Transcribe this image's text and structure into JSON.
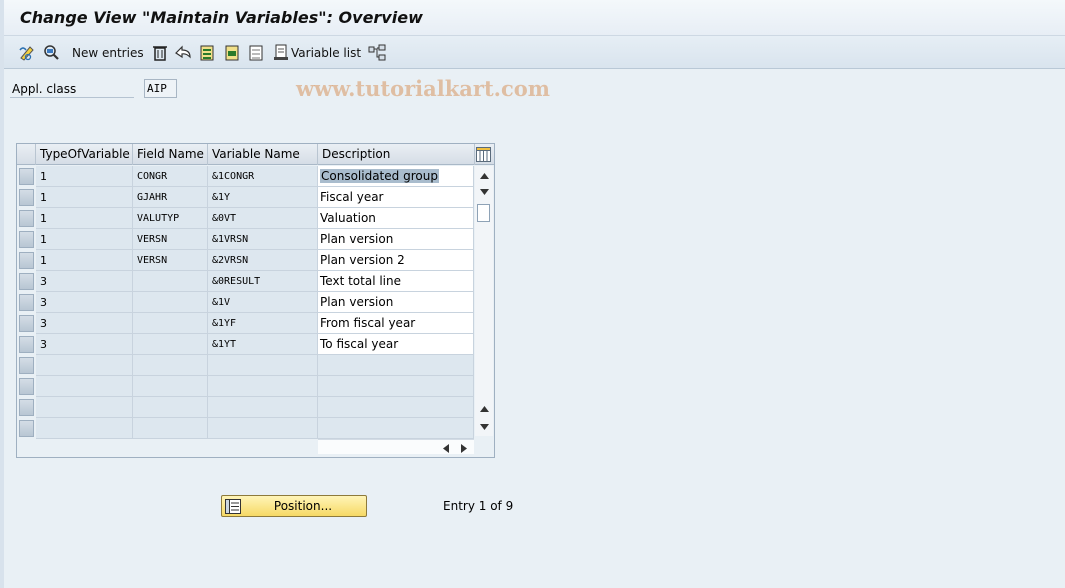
{
  "window": {
    "title": "Change View \"Maintain Variables\": Overview"
  },
  "toolbar": {
    "new_entries_label": "New entries",
    "variable_list_label": "Variable list",
    "icons": [
      "display-change-icon",
      "details-icon",
      "new-entries-icon",
      "delete-icon",
      "undo-icon",
      "select-all-icon",
      "select-block-icon",
      "deselect-all-icon",
      "print-icon",
      "variable-list-icon",
      "structure-icon"
    ]
  },
  "watermark": "www.tutorialkart.com",
  "form": {
    "appl_class_label": "Appl. class",
    "appl_class_value": "AIP"
  },
  "table": {
    "columns": [
      "TypeOfVariable",
      "Field Name",
      "Variable Name",
      "Description"
    ],
    "rows": [
      {
        "type": "1",
        "field": "CONGR",
        "variable": "&1CONGR",
        "description": "Consolidated group"
      },
      {
        "type": "1",
        "field": "GJAHR",
        "variable": "&1Y",
        "description": "Fiscal year"
      },
      {
        "type": "1",
        "field": "VALUTYP",
        "variable": "&0VT",
        "description": "Valuation"
      },
      {
        "type": "1",
        "field": "VERSN",
        "variable": "&1VRSN",
        "description": "Plan version"
      },
      {
        "type": "1",
        "field": "VERSN",
        "variable": "&2VRSN",
        "description": "Plan version 2"
      },
      {
        "type": "3",
        "field": "",
        "variable": "&0RESULT",
        "description": "Text total line"
      },
      {
        "type": "3",
        "field": "",
        "variable": "&1V",
        "description": "Plan version"
      },
      {
        "type": "3",
        "field": "",
        "variable": "&1YF",
        "description": "From fiscal year"
      },
      {
        "type": "3",
        "field": "",
        "variable": "&1YT",
        "description": "To fiscal year"
      }
    ],
    "empty_rows": 4
  },
  "footer": {
    "position_button_label": "Position...",
    "entry_text": "Entry 1 of 9"
  },
  "colors": {
    "background": "#e9f0f5",
    "button_yellow": "#f6d965",
    "selection_highlight": "#a9bccd"
  }
}
